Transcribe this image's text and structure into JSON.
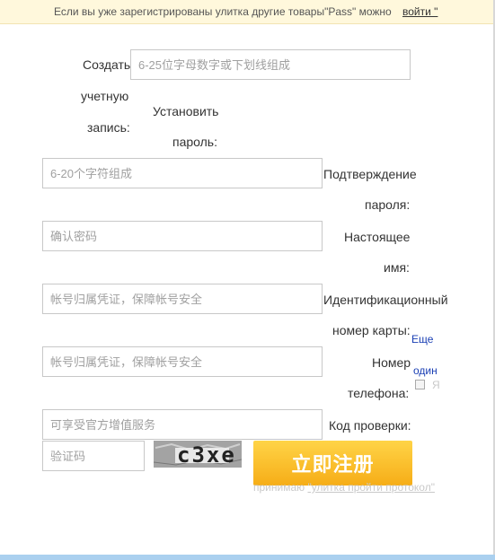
{
  "top_bar": {
    "message": "Если вы уже зарегистрированы улитка другие товары\"Pass\" можно",
    "login_link": "войти \""
  },
  "form": {
    "create_account_label": [
      "Создать",
      "учетную",
      "запись:"
    ],
    "username_placeholder": "6-25位字母数字或下划线组成",
    "set_password_label": [
      "Установить",
      "пароль:"
    ],
    "password_placeholder": "6-20个字符组成",
    "confirm_password_label": [
      "Подтверждение",
      "пароля:"
    ],
    "confirm_password_placeholder": "确认密码",
    "real_name_label": [
      "Настоящее",
      "имя:"
    ],
    "real_name_placeholder": "帐号归属凭证，保障帐号安全",
    "id_card_label": [
      "Идентификационный",
      "номер карты:"
    ],
    "id_card_placeholder": "帐号归属凭证，保障帐号安全",
    "phone_label": [
      "Номер",
      "телефона:"
    ],
    "phone_placeholder": "可享受官方增值服务",
    "code_label": "Код проверки:",
    "code_placeholder": "验证码",
    "captcha_text": "c3xe",
    "another_link": [
      "Еще",
      "один"
    ],
    "agree_prefix": "Я",
    "agree_text": "принимаю",
    "agree_protocol": "\"улитка пройти протокол\"",
    "submit_label": "立即注册"
  }
}
